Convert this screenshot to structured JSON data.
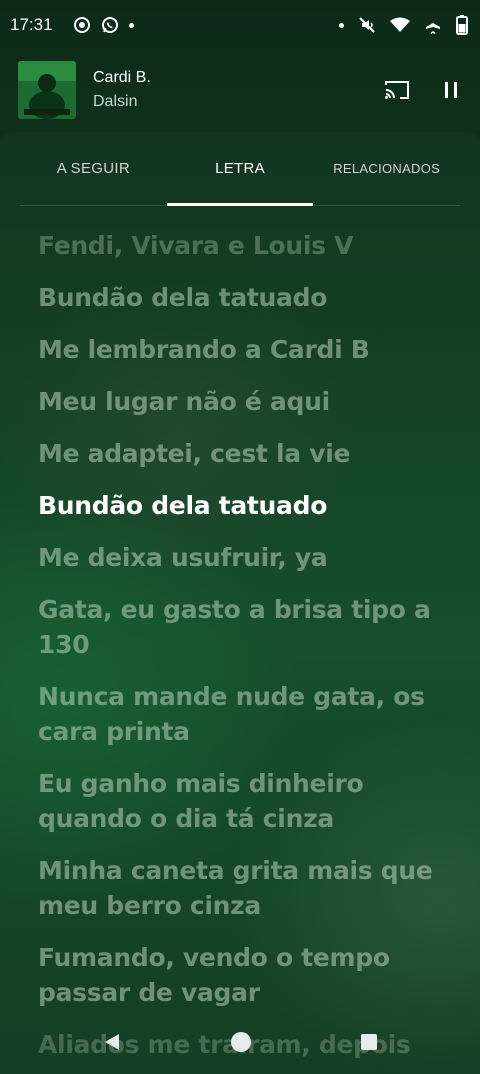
{
  "status_bar": {
    "time": "17:31",
    "left_icons": [
      "screen-record-icon",
      "whatsapp-icon",
      "dot-icon"
    ],
    "right_icons": [
      "dot-icon",
      "vibrate-off-icon",
      "wifi-icon",
      "airplane-icon",
      "battery-icon"
    ]
  },
  "mini_player": {
    "title": "Cardi B.",
    "artist": "Dalsin"
  },
  "tabs": [
    {
      "label": "A SEGUIR",
      "active": false
    },
    {
      "label": "LETRA",
      "active": true
    },
    {
      "label": "RELACIONADOS",
      "active": false
    }
  ],
  "lyrics": [
    "Fendi, Vivara e Louis V",
    "Bundão dela tatuado",
    "Me lembrando a Cardi B",
    "Meu lugar não é aqui",
    "Me adaptei, cest la vie",
    "Bundão dela tatuado",
    "Me deixa usufruir, ya",
    "Gata, eu gasto a brisa tipo a 130",
    "Nunca mande nude gata, os cara printa",
    "Eu ganho mais dinheiro quando o dia tá cinza",
    "Minha caneta grita mais que meu berro cinza",
    "Fumando, vendo o tempo passar de vagar",
    "Aliados me traíram, depois"
  ],
  "active_lyric_index": 5,
  "colors": {
    "active_lyric": "#ffffff",
    "inactive_lyric": "#b9d2be",
    "background": "#124a26"
  }
}
